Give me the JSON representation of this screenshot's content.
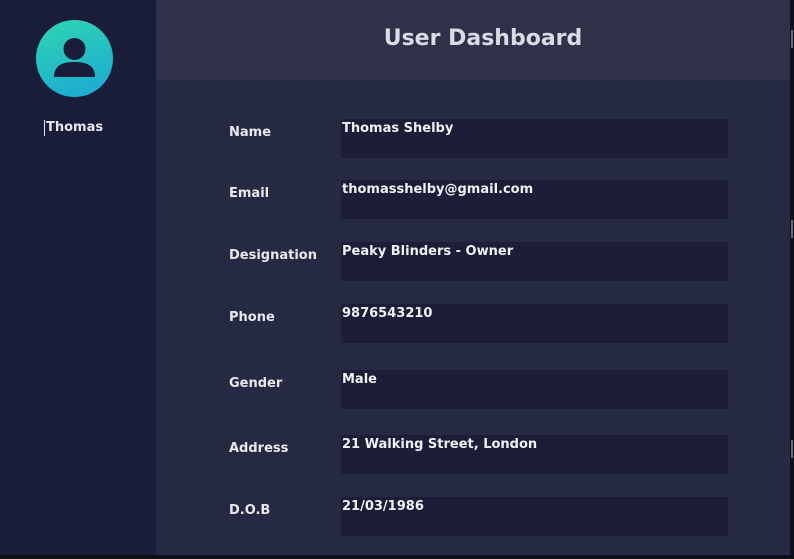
{
  "sidebar": {
    "avatar_icon": "user-avatar-icon",
    "user_name": "Thomas"
  },
  "header": {
    "title": "User Dashboard"
  },
  "profile": {
    "fields": [
      {
        "label": "Name",
        "value": "Thomas Shelby"
      },
      {
        "label": "Email",
        "value": "thomasshelby@gmail.com"
      },
      {
        "label": "Designation",
        "value": "Peaky Blinders - Owner"
      },
      {
        "label": "Phone",
        "value": "9876543210"
      },
      {
        "label": "Gender",
        "value": "Male"
      },
      {
        "label": "Address",
        "value": "21 Walking Street, London"
      },
      {
        "label": "D.O.B",
        "value": "21/03/1986"
      }
    ]
  },
  "colors": {
    "sidebar_bg": "#1a1d39",
    "header_bg": "#2e3148",
    "content_bg": "#262942",
    "field_bg": "#1b1e36",
    "avatar_gradient_start": "#2fd6b1",
    "avatar_gradient_end": "#1aa7d6"
  }
}
